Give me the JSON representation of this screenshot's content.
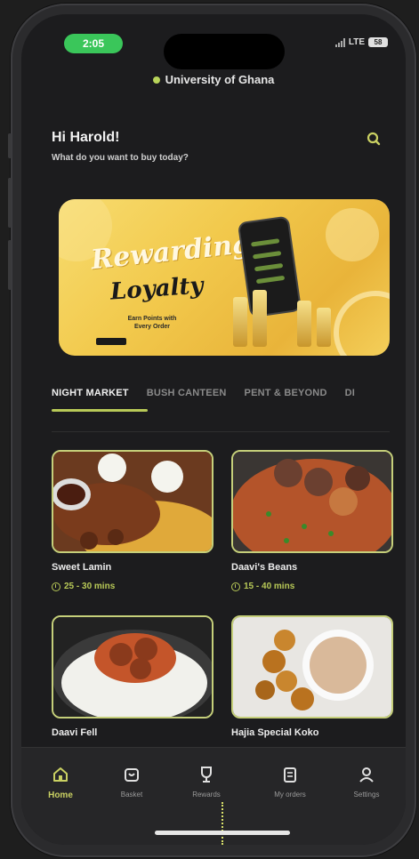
{
  "status_bar": {
    "time": "2:05",
    "network": "LTE",
    "battery": "58"
  },
  "location": {
    "name": "University of Ghana"
  },
  "greeting": {
    "title": "Hi Harold!",
    "subtitle": "What do you want to buy today?"
  },
  "banner": {
    "script_line1": "Rewarding",
    "script_line2": "Loyalty",
    "tagline": "Earn Points with Every Order"
  },
  "tabs": [
    {
      "label": "NIGHT MARKET",
      "active": true
    },
    {
      "label": "BUSH CANTEEN",
      "active": false
    },
    {
      "label": "PENT & BEYOND",
      "active": false
    },
    {
      "label": "DI",
      "active": false
    }
  ],
  "vendors": [
    {
      "name": "Sweet Lamin",
      "time": "25 - 30 mins"
    },
    {
      "name": "Daavi's Beans",
      "time": "15 - 40 mins"
    },
    {
      "name": "Daavi Fell",
      "time": ""
    },
    {
      "name": "Hajia Special Koko",
      "time": ""
    }
  ],
  "bottom_nav": [
    {
      "label": "Home",
      "icon": "home-icon",
      "active": true
    },
    {
      "label": "Basket",
      "icon": "basket-icon",
      "active": false
    },
    {
      "label": "Rewards",
      "icon": "trophy-icon",
      "active": false
    },
    {
      "label": "My orders",
      "icon": "orders-icon",
      "active": false
    },
    {
      "label": "Settings",
      "icon": "user-icon",
      "active": false
    }
  ],
  "colors": {
    "accent": "#b8c957",
    "background": "#1c1c1e",
    "banner": "#f2c94c"
  }
}
